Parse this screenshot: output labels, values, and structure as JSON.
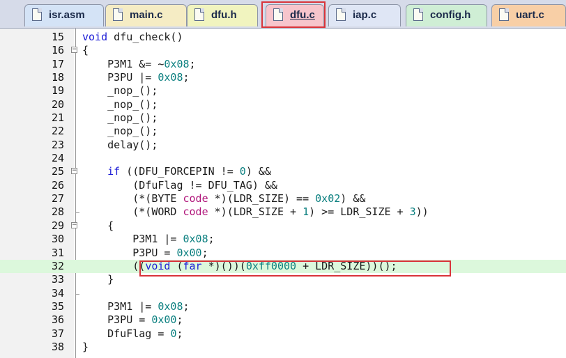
{
  "tabs": [
    {
      "label": "isr.asm",
      "icon": "asm-file-icon",
      "color": "#d4e3f6"
    },
    {
      "label": "main.c",
      "icon": "c-file-icon",
      "color": "#f5ecc4"
    },
    {
      "label": "dfu.h",
      "icon": "h-file-icon",
      "color": "#f1f4bf"
    },
    {
      "label": "dfu.c",
      "icon": "c-file-icon",
      "color": "#f7c5cc",
      "active": true
    },
    {
      "label": "iap.c",
      "icon": "c-file-icon",
      "color": "#dfe6f5"
    },
    {
      "label": "config.h",
      "icon": "h-file-icon",
      "color": "#cfeed5"
    },
    {
      "label": "uart.c",
      "icon": "c-file-icon",
      "color": "#f8cfa6"
    }
  ],
  "code": {
    "current_line": 32,
    "lines": [
      {
        "n": "15",
        "text": "void dfu_check()"
      },
      {
        "n": "16",
        "text": "{",
        "fold": "open"
      },
      {
        "n": "17",
        "text": "    P3M1 &= ~0x08;"
      },
      {
        "n": "18",
        "text": "    P3PU |= 0x08;"
      },
      {
        "n": "19",
        "text": "    _nop_();"
      },
      {
        "n": "20",
        "text": "    _nop_();"
      },
      {
        "n": "21",
        "text": "    _nop_();"
      },
      {
        "n": "22",
        "text": "    _nop_();"
      },
      {
        "n": "23",
        "text": "    delay();"
      },
      {
        "n": "24",
        "text": ""
      },
      {
        "n": "25",
        "text": "    if ((DFU_FORCEPIN != 0) &&",
        "fold": "open"
      },
      {
        "n": "26",
        "text": "        (DfuFlag != DFU_TAG) &&"
      },
      {
        "n": "27",
        "text": "        (*(BYTE code *)(LDR_SIZE) == 0x02) &&"
      },
      {
        "n": "28",
        "text": "        (*(WORD code *)(LDR_SIZE + 1) >= LDR_SIZE + 3))",
        "fold": "end"
      },
      {
        "n": "29",
        "text": "    {",
        "fold": "open"
      },
      {
        "n": "30",
        "text": "        P3M1 |= 0x08;"
      },
      {
        "n": "31",
        "text": "        P3PU = 0x00;"
      },
      {
        "n": "32",
        "text": "        ((void (far *)())(0xff0000 + LDR_SIZE))();"
      },
      {
        "n": "33",
        "text": "    }"
      },
      {
        "n": "34",
        "text": "",
        "fold": "end"
      },
      {
        "n": "35",
        "text": "    P3M1 |= 0x08;"
      },
      {
        "n": "36",
        "text": "    P3PU = 0x00;"
      },
      {
        "n": "37",
        "text": "    DfuFlag = 0;"
      },
      {
        "n": "38",
        "text": "}"
      }
    ]
  },
  "colors": {
    "keyword": "#1d1dd6",
    "number": "#0a7f7f",
    "code_keyword": "#b0147a",
    "current_line_bg": "#dcf8dc",
    "highlight_box": "#d9343a"
  }
}
